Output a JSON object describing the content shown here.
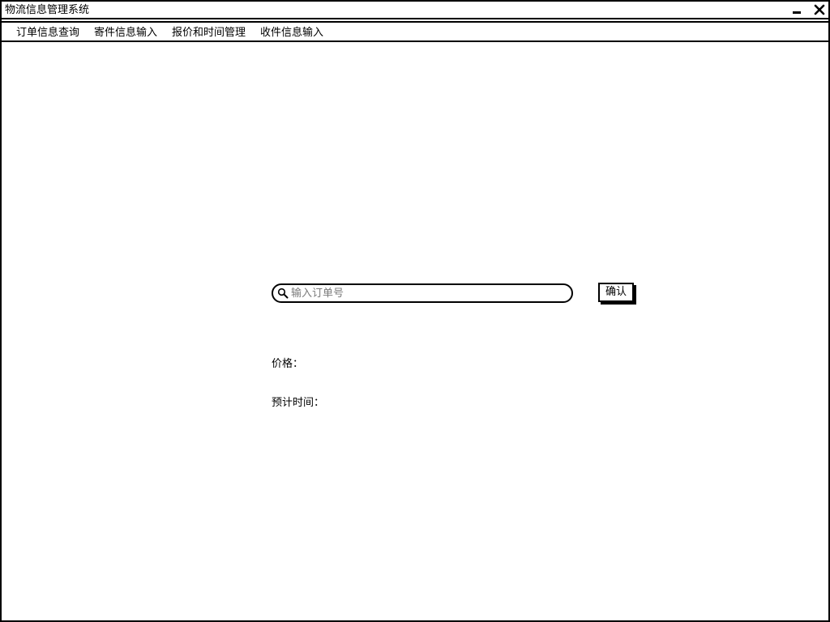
{
  "window": {
    "title": "物流信息管理系统"
  },
  "menu": {
    "items": [
      {
        "label": "订单信息查询"
      },
      {
        "label": "寄件信息输入"
      },
      {
        "label": "报价和时间管理"
      },
      {
        "label": "收件信息输入"
      }
    ]
  },
  "search": {
    "placeholder": "输入订单号",
    "value": "",
    "icon": "search-icon"
  },
  "confirm_button": {
    "label": "确认"
  },
  "fields": {
    "price_label": "价格：",
    "time_label": "预计时间："
  }
}
